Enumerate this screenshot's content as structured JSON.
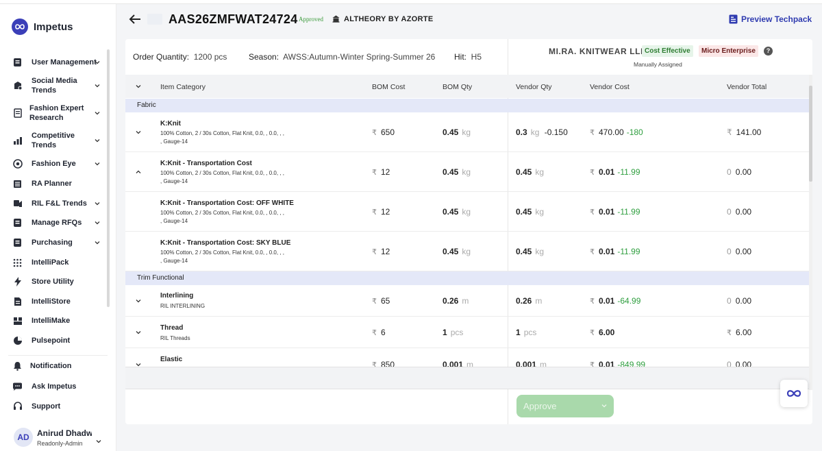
{
  "app": {
    "name": "Impetus"
  },
  "sidebar": {
    "items": [
      {
        "label": "User Management",
        "icon": "user-management-icon",
        "chevron": true
      },
      {
        "label": "Social Media Trends",
        "icon": "social-media-icon",
        "chevron": true
      },
      {
        "label": "Fashion Expert Research",
        "icon": "document-icon",
        "chevron": true
      },
      {
        "label": "Competitive Trends",
        "icon": "bar-chart-icon",
        "chevron": true
      },
      {
        "label": "Fashion Eye",
        "icon": "eye-icon",
        "chevron": true
      },
      {
        "label": "RA Planner",
        "icon": "planner-icon",
        "chevron": false
      },
      {
        "label": "RIL F&L Trends",
        "icon": "trends-icon",
        "chevron": true
      },
      {
        "label": "Manage RFQs",
        "icon": "rfq-icon",
        "chevron": true
      },
      {
        "label": "Purchasing",
        "icon": "purchasing-icon",
        "chevron": true
      },
      {
        "label": "IntelliPack",
        "icon": "grid-dots-icon",
        "chevron": false
      },
      {
        "label": "Store Utility",
        "icon": "bolt-icon",
        "chevron": false
      },
      {
        "label": "IntelliStore",
        "icon": "file-icon",
        "chevron": false
      },
      {
        "label": "IntelliMake",
        "icon": "build-icon",
        "chevron": false
      },
      {
        "label": "Pulsepoint",
        "icon": "pie-icon",
        "chevron": false
      }
    ],
    "bottom_items": [
      {
        "label": "Notification",
        "icon": "bell-icon"
      },
      {
        "label": "Ask Impetus",
        "icon": "chat-icon"
      },
      {
        "label": "Support",
        "icon": "headset-icon"
      }
    ],
    "user": {
      "initials": "AD",
      "name": "Anirud Dhadwal",
      "role": "Readonly-Admin"
    }
  },
  "header": {
    "style_code": "AAS26ZMFWAT24724",
    "status": "Approved",
    "brand": "ALTHEORY BY AZORTE",
    "preview_label": "Preview Techpack"
  },
  "order": {
    "quantity_label": "Order Quantity:",
    "quantity_value": "1200 pcs",
    "season_label": "Season:",
    "season_value": "AWSS:Autumn-Winter Spring-Summer 26",
    "hit_label": "Hit:",
    "hit_value": "H5"
  },
  "vendor": {
    "name": "MI.RA. KNITWEAR LLP",
    "tag_cost": "Cost Effective",
    "tag_size": "Micro Enterprise",
    "assignment": "Manually Assigned"
  },
  "table": {
    "columns": [
      "Item Category",
      "BOM Cost",
      "BOM Qty",
      "Vendor Qty",
      "Vendor Cost",
      "Vendor Total"
    ],
    "currency": "₹",
    "sections": [
      {
        "name": "Fabric",
        "rows": [
          {
            "title": "K:Knit",
            "desc": "100% Cotton, 2 / 30s Cotton, Flat Knit, 0.0, , 0.0, , , , Gauge-14",
            "bom_cost": "650",
            "bom_qty": "0.45",
            "bom_unit": "kg",
            "vendor_qty": "0.3",
            "vendor_unit": "kg",
            "vendor_qty_diff": "-0.150",
            "vendor_cost": "470.00",
            "vendor_cost_diff": "-180",
            "total_prefix": "₹",
            "vendor_total": "141.00",
            "expanded": false
          },
          {
            "title": "K:Knit - Transportation Cost",
            "desc": "100% Cotton, 2 / 30s Cotton, Flat Knit, 0.0, , 0.0, , , , Gauge-14",
            "bom_cost": "12",
            "bom_qty": "0.45",
            "bom_unit": "kg",
            "vendor_qty": "0.45",
            "vendor_unit": "kg",
            "vendor_qty_diff": "",
            "vendor_cost": "0.01",
            "vendor_cost_diff": "-11.99",
            "total_prefix": "0",
            "vendor_total": "0.00",
            "expanded": true
          },
          {
            "title": "K:Knit - Transportation Cost: OFF WHITE",
            "desc": "100% Cotton, 2 / 30s Cotton, Flat Knit, 0.0, , 0.0, , , , Gauge-14",
            "bom_cost": "12",
            "bom_qty": "0.45",
            "bom_unit": "kg",
            "vendor_qty": "0.45",
            "vendor_unit": "kg",
            "vendor_qty_diff": "",
            "vendor_cost": "0.01",
            "vendor_cost_diff": "-11.99",
            "total_prefix": "0",
            "vendor_total": "0.00",
            "expanded": null
          },
          {
            "title": "K:Knit - Transportation Cost: SKY BLUE",
            "desc": "100% Cotton, 2 / 30s Cotton, Flat Knit, 0.0, , 0.0, , , , Gauge-14",
            "bom_cost": "12",
            "bom_qty": "0.45",
            "bom_unit": "kg",
            "vendor_qty": "0.45",
            "vendor_unit": "kg",
            "vendor_qty_diff": "",
            "vendor_cost": "0.01",
            "vendor_cost_diff": "-11.99",
            "total_prefix": "0",
            "vendor_total": "0.00",
            "expanded": null
          }
        ]
      },
      {
        "name": "Trim Functional",
        "rows": [
          {
            "title": "Interlining",
            "desc": "RIL INTERLINING",
            "bom_cost": "65",
            "bom_qty": "0.26",
            "bom_unit": "m",
            "vendor_qty": "0.26",
            "vendor_unit": "m",
            "vendor_qty_diff": "",
            "vendor_cost": "0.01",
            "vendor_cost_diff": "-64.99",
            "total_prefix": "0",
            "vendor_total": "0.00",
            "expanded": false
          },
          {
            "title": "Thread",
            "desc": "RIL Threads",
            "bom_cost": "6",
            "bom_qty": "1",
            "bom_unit": "pcs",
            "vendor_qty": "1",
            "vendor_unit": "pcs",
            "vendor_qty_diff": "",
            "vendor_cost": "6.00",
            "vendor_cost_diff": "",
            "total_prefix": "₹",
            "vendor_total": "6.00",
            "expanded": false
          },
          {
            "title": "Elastic",
            "desc": "",
            "bom_cost": "850",
            "bom_qty": "0.001",
            "bom_unit": "m",
            "vendor_qty": "0.001",
            "vendor_unit": "m",
            "vendor_qty_diff": "",
            "vendor_cost": "0.01",
            "vendor_cost_diff": "-849.99",
            "total_prefix": "0",
            "vendor_total": "0.00",
            "expanded": false
          }
        ]
      }
    ]
  },
  "actions": {
    "approve_label": "Approve"
  },
  "colors": {
    "accent": "#3b3fb8",
    "positive": "#2e9e3e",
    "approve_bg": "#a9d9ab"
  }
}
